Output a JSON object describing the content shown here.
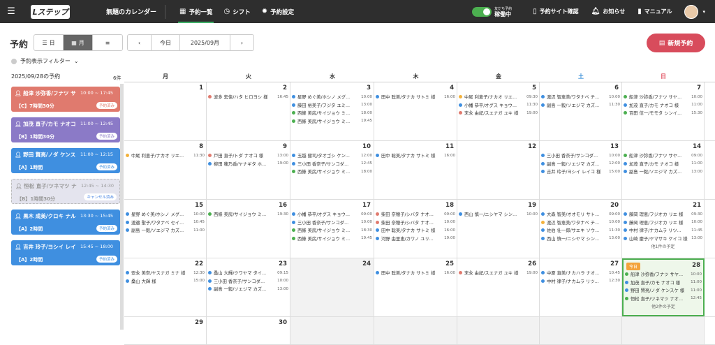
{
  "app": {
    "logo": "Lステップ",
    "calendar_name": "無題のカレンダー"
  },
  "nav": [
    {
      "label": "予約一覧"
    },
    {
      "label": "シフト"
    },
    {
      "label": "予約設定"
    }
  ],
  "right_nav": {
    "toggle_top": "友だち予約",
    "toggle_label": "稼働中",
    "site_confirm": "予約サイト確認",
    "notice": "お知らせ",
    "manual": "マニュアル"
  },
  "toolbar": {
    "title": "予約",
    "day": "日",
    "month": "月",
    "today": "今日",
    "month_label": "2025/09月",
    "new_button": "新規予約"
  },
  "filter": {
    "label": "予約表示フィルター"
  },
  "sidebar": {
    "date": "2025/09/28の予約",
    "count": "6件",
    "cards": [
      {
        "name": "船津 沙弥香/フナツ サ",
        "time": "10:00 ~ 17:45",
        "line": "【C】7時間30分",
        "badge": "予約済み",
        "color": "#e07a6e"
      },
      {
        "name": "加茂 直子/カモ ナオコ",
        "time": "11:00 ~ 12:45",
        "line": "【B】1時間30分",
        "badge": "予約済み",
        "color": "#8b7ac7"
      },
      {
        "name": "野田 賢亮/ノダ ケンス",
        "time": "11:00 ~ 12:15",
        "line": "【A】1時間",
        "badge": "予約済み",
        "color": "#3f8fe0"
      },
      {
        "name": "恒松 直子/ツネマツ ナ",
        "time": "12:45 ~ 14:30",
        "line": "【B】1時間30分",
        "badge": "キャンセル済み",
        "color": ""
      },
      {
        "name": "黒木 成美/クロキ ナル",
        "time": "13:30 ~ 15:45",
        "line": "【A】2時間",
        "badge": "予約済み",
        "color": "#3f8fe0"
      },
      {
        "name": "吉井 玲子/ヨシイ レイ",
        "time": "15:45 ~ 18:00",
        "line": "【A】2時間",
        "badge": "予約済み",
        "color": "#3f8fe0"
      }
    ]
  },
  "calendar": {
    "dow": [
      "月",
      "火",
      "水",
      "木",
      "金",
      "土",
      "日"
    ],
    "dow_colors": [
      "#333",
      "#333",
      "#333",
      "#333",
      "#333",
      "#3a8fd8",
      "#e04a5a"
    ],
    "today_badge": "今日",
    "weeks": [
      [
        {
          "num": "1",
          "events": []
        },
        {
          "num": "2",
          "events": [
            {
              "c": "#e07a6e",
              "t": "波多 宏佳/ハタ ヒロヨシ 様",
              "tm": "16:45"
            }
          ]
        },
        {
          "num": "3",
          "events": [
            {
              "c": "#3f8fe0",
              "t": "星野 めぐ美/ホシノ メグ...",
              "tm": "10:00"
            },
            {
              "c": "#3f8fe0",
              "t": "藤田 裕美子/フジタ ユミ...",
              "tm": "13:00"
            },
            {
              "c": "#4caf50",
              "t": "西條 美房/サイジョウ ミ...",
              "tm": "18:00"
            },
            {
              "c": "#4caf50",
              "t": "西條 美房/サイジョウ ミ...",
              "tm": "19:45"
            }
          ]
        },
        {
          "num": "4",
          "events": [
            {
              "c": "#3f8fe0",
              "t": "田中 聡美/タナカ サトミ 様",
              "tm": "16:00"
            }
          ]
        },
        {
          "num": "5",
          "events": [
            {
              "c": "#f3b23c",
              "t": "中尾 利恵子/ナカオ リエ...",
              "tm": "09:30"
            },
            {
              "c": "#3f8fe0",
              "t": "小幡 恭平/オグス キョウ...",
              "tm": "11:30"
            },
            {
              "c": "#e07a6e",
              "t": "末永 由紀/スエナガ ユキ 様",
              "tm": "19:00"
            }
          ]
        },
        {
          "num": "6",
          "events": [
            {
              "c": "#3f8fe0",
              "t": "渡辺 智恵美/ワタナベ チ...",
              "tm": "10:00"
            },
            {
              "c": "#3f8fe0",
              "t": "副島 一毅/ソエジマ カズ...",
              "tm": "11:30"
            }
          ]
        },
        {
          "num": "7",
          "events": [
            {
              "c": "#4caf50",
              "t": "船津 沙弥香/フナツ サヤ...",
              "tm": "10:00"
            },
            {
              "c": "#3f8fe0",
              "t": "加茂 直子/カモ ナオコ 様",
              "tm": "11:00"
            },
            {
              "c": "#4caf50",
              "t": "百田 信一/モモタ シンイ...",
              "tm": "15:30"
            }
          ]
        }
      ],
      [
        {
          "num": "8",
          "events": [
            {
              "c": "#f3b23c",
              "t": "中尾 利恵子/ナカオ リエ...",
              "tm": "11:30"
            }
          ]
        },
        {
          "num": "9",
          "events": [
            {
              "c": "#e07a6e",
              "t": "戸田 直子/トダ ナオコ 様",
              "tm": "13:00"
            },
            {
              "c": "#3f8fe0",
              "t": "柳田 穂乃香/ヤナギタ ホ...",
              "tm": "19:00"
            }
          ]
        },
        {
          "num": "10",
          "events": [
            {
              "c": "#3f8fe0",
              "t": "玉越 健司/タオゴシ ケン...",
              "tm": "12:00"
            },
            {
              "c": "#3f8fe0",
              "t": "三小田 香奈子/サンコダ...",
              "tm": "12:45"
            },
            {
              "c": "#4caf50",
              "t": "西條 美房/サイジョウ ミ...",
              "tm": "18:00"
            }
          ]
        },
        {
          "num": "11",
          "events": [
            {
              "c": "#3f8fe0",
              "t": "田中 聡美/タナカ サトミ 様",
              "tm": "16:00"
            }
          ]
        },
        {
          "num": "12",
          "events": []
        },
        {
          "num": "13",
          "events": [
            {
              "c": "#3f8fe0",
              "t": "三小田 香奈子/サンコダ...",
              "tm": "10:00"
            },
            {
              "c": "#3f8fe0",
              "t": "副島 一毅/ソエジマ カズ...",
              "tm": "12:00"
            },
            {
              "c": "#3f8fe0",
              "t": "吉井 玲子/ヨシイ レイコ 様",
              "tm": "15:00"
            }
          ]
        },
        {
          "num": "14",
          "events": [
            {
              "c": "#4caf50",
              "t": "船津 沙弥香/フナツ サヤ...",
              "tm": "09:00"
            },
            {
              "c": "#3f8fe0",
              "t": "加茂 直子/カモ ナオコ 様",
              "tm": "11:00"
            },
            {
              "c": "#3f8fe0",
              "t": "副島 一毅/ソエジマ カズ...",
              "tm": "13:00"
            }
          ]
        }
      ],
      [
        {
          "num": "15",
          "events": [
            {
              "c": "#3f8fe0",
              "t": "星野 めぐ美/ホシノ メグ...",
              "tm": "10:00"
            },
            {
              "c": "#3f8fe0",
              "t": "渡邉 聖子/ワタナベ セイ...",
              "tm": "10:45"
            },
            {
              "c": "#3f8fe0",
              "t": "副島 一毅/ソエジマ カズ...",
              "tm": "11:00"
            }
          ]
        },
        {
          "num": "16",
          "events": [
            {
              "c": "#4caf50",
              "t": "西條 美房/サイジョウ ミ...",
              "tm": "19:30"
            }
          ]
        },
        {
          "num": "17",
          "events": [
            {
              "c": "#3f8fe0",
              "t": "小幡 恭平/オグス キョウ...",
              "tm": "09:00"
            },
            {
              "c": "#3f8fe0",
              "t": "三小田 香奈子/サンコダ...",
              "tm": "10:00"
            },
            {
              "c": "#4caf50",
              "t": "西條 美房/サイジョウ ミ...",
              "tm": "18:30"
            },
            {
              "c": "#4caf50",
              "t": "西條 美房/サイジョウ ミ...",
              "tm": "19:45"
            }
          ]
        },
        {
          "num": "18",
          "events": [
            {
              "c": "#e07a6e",
              "t": "柴田 奈穂子/シバタ ナオ...",
              "tm": "09:00"
            },
            {
              "c": "#e07a6e",
              "t": "柴田 奈穂子/シバタ ナオ...",
              "tm": "10:00"
            },
            {
              "c": "#3f8fe0",
              "t": "田中 聡美/タナカ サトミ 様",
              "tm": "16:00"
            },
            {
              "c": "#3f8fe0",
              "t": "河野 由里恵/カワノ ユリ...",
              "tm": "19:00"
            }
          ]
        },
        {
          "num": "19",
          "events": [
            {
              "c": "#3f8fe0",
              "t": "西山 慎一/ニシヤマ シン...",
              "tm": "10:00"
            }
          ]
        },
        {
          "num": "20",
          "events": [
            {
              "c": "#3f8fe0",
              "t": "大森 智美/オオモリ サト...",
              "tm": "09:00"
            },
            {
              "c": "#f3b23c",
              "t": "渡辺 智恵美/ワタナベ チ...",
              "tm": "10:00"
            },
            {
              "c": "#3f8fe0",
              "t": "佐伯 壮一郎/サエキ ソウ...",
              "tm": "11:30"
            },
            {
              "c": "#3f8fe0",
              "t": "西山 慎一/ニシヤマ シン...",
              "tm": "13:00"
            }
          ]
        },
        {
          "num": "21",
          "events": [
            {
              "c": "#3f8fe0",
              "t": "藤岡 理恵/フジオカ リエ 様",
              "tm": "09:30"
            },
            {
              "c": "#3f8fe0",
              "t": "藤岡 理恵/フジオカ リエ 様",
              "tm": "10:00"
            },
            {
              "c": "#3f8fe0",
              "t": "中村 律子/ナカムラ リツ...",
              "tm": "11:45"
            },
            {
              "c": "#3f8fe0",
              "t": "山崎 慶子/ヤマサキ ケイコ 様",
              "tm": "13:00"
            }
          ],
          "more": "他1件の予定"
        }
      ],
      [
        {
          "num": "22",
          "events": [
            {
              "c": "#3f8fe0",
              "t": "安永 美奈/ヤスナガ ミナ 様",
              "tm": "12:30"
            },
            {
              "c": "#3f8fe0",
              "t": "桑山 大輝 様",
              "tm": "15:00"
            }
          ]
        },
        {
          "num": "23",
          "events": [
            {
              "c": "#3f8fe0",
              "t": "桑山 大輝/クワヤマ タイ...",
              "tm": "09:15"
            },
            {
              "c": "#3f8fe0",
              "t": "三小田 香奈子/サンコダ...",
              "tm": "10:00"
            },
            {
              "c": "#3f8fe0",
              "t": "副島 一毅/ソエジマ カズ...",
              "tm": "13:00"
            }
          ]
        },
        {
          "num": "24",
          "events": [],
          "gray": true
        },
        {
          "num": "25",
          "events": [
            {
              "c": "#3f8fe0",
              "t": "田中 聡美/タナカ サトミ 様",
              "tm": "16:00"
            }
          ]
        },
        {
          "num": "26",
          "events": [
            {
              "c": "#e07a6e",
              "t": "末永 由紀/スエナガ ユキ 様",
              "tm": "19:00"
            }
          ]
        },
        {
          "num": "27",
          "events": [
            {
              "c": "#3f8fe0",
              "t": "中原 直美/ナカハラ ナオ...",
              "tm": "10:45"
            },
            {
              "c": "#3f8fe0",
              "t": "中村 律子/ナカムラ リツ...",
              "tm": "12:30"
            }
          ]
        },
        {
          "num": "28",
          "today": true,
          "events": [
            {
              "c": "#4caf50",
              "t": "船津 沙弥香/フナツ サヤ...",
              "tm": "10:00"
            },
            {
              "c": "#3f8fe0",
              "t": "加茂 直子/カモ ナオコ 様",
              "tm": "11:00"
            },
            {
              "c": "#3f8fe0",
              "t": "野田 賢亮/ノダ ケンスケ 様",
              "tm": "11:00"
            },
            {
              "c": "#4caf50",
              "t": "恒松 直子/ツネマツ ナオ...",
              "tm": "12:45"
            }
          ],
          "more": "他2件の予定"
        }
      ],
      [
        {
          "num": "29",
          "events": []
        },
        {
          "num": "30",
          "events": []
        },
        {
          "num": "",
          "events": [],
          "gray": true
        },
        {
          "num": "",
          "events": [],
          "gray": true
        },
        {
          "num": "",
          "events": [],
          "gray": true
        },
        {
          "num": "",
          "events": [],
          "gray": true
        },
        {
          "num": "",
          "events": [],
          "gray": true
        }
      ]
    ]
  }
}
